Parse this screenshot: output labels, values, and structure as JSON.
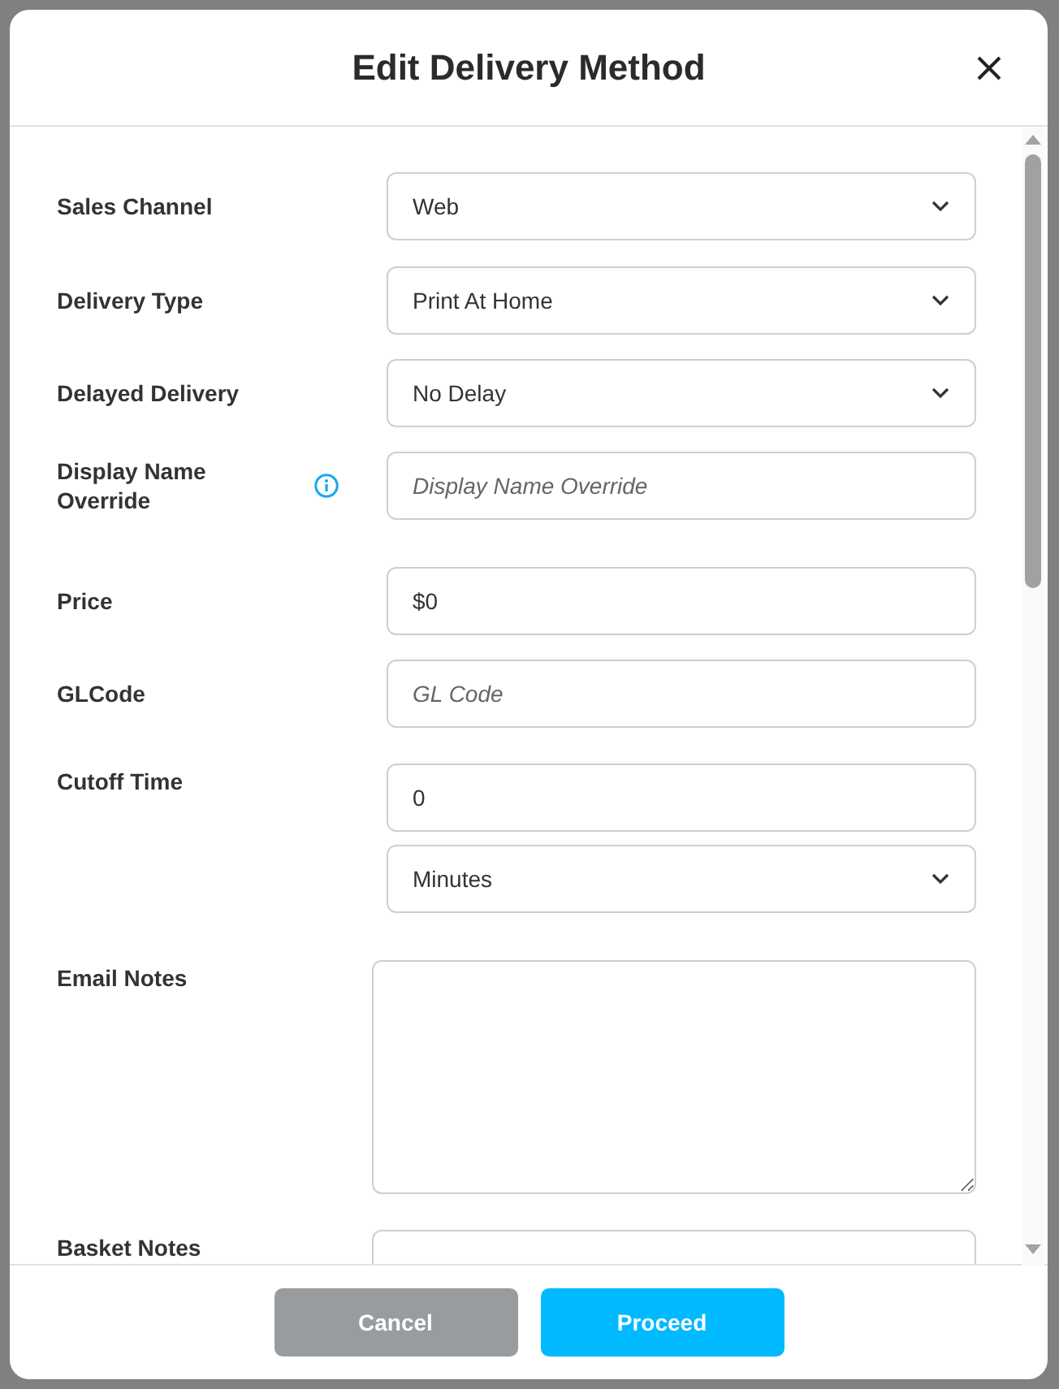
{
  "dialog": {
    "title": "Edit Delivery Method"
  },
  "fields": [
    {
      "label": "Sales Channel",
      "kind": "select",
      "value": "Web"
    },
    {
      "label": "Delivery Type",
      "kind": "select",
      "value": "Print At Home"
    },
    {
      "label": "Delayed Delivery",
      "kind": "select",
      "value": "No Delay"
    },
    {
      "label": "Display Name Override",
      "kind": "input",
      "placeholder": "Display Name Override",
      "info": true
    },
    {
      "label": "Price",
      "kind": "input",
      "value": "$0"
    },
    {
      "label": "GLCode",
      "kind": "input",
      "placeholder": "GL Code"
    },
    {
      "label": "Cutoff Time",
      "kind": "input",
      "value": "0",
      "unit": "Minutes"
    },
    {
      "label": "Email Notes",
      "kind": "textarea"
    },
    {
      "label": "Basket Notes",
      "kind": "textarea"
    }
  ],
  "buttons": [
    {
      "label": "Cancel",
      "kind": "secondary"
    },
    {
      "label": "Proceed",
      "kind": "primary"
    }
  ]
}
